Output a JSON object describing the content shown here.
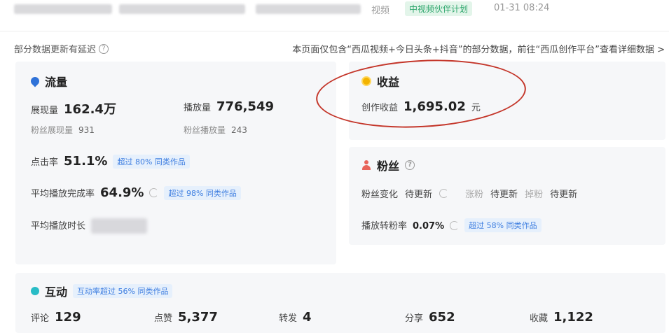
{
  "header": {
    "tag_video": "视频",
    "tag_plan": "中视频伙伴计划",
    "timestamp": "01-31 08:24"
  },
  "notice": {
    "left": "部分数据更新有延迟",
    "right": "本页面仅包含“西瓜视频+今日头条+抖音”的部分数据，前往“西瓜创作平台”查看详细数据 >"
  },
  "traffic": {
    "title": "流量",
    "impressions_label": "展现量",
    "impressions_value": "162.4万",
    "plays_label": "播放量",
    "plays_value": "776,549",
    "fan_impressions_label": "粉丝展现量",
    "fan_impressions_value": "931",
    "fan_plays_label": "粉丝播放量",
    "fan_plays_value": "243",
    "ctr_label": "点击率",
    "ctr_value": "51.1%",
    "ctr_badge": "超过 80% 同类作品",
    "completion_label": "平均播放完成率",
    "completion_value": "64.9%",
    "completion_badge": "超过 98% 同类作品",
    "duration_label": "平均播放时长"
  },
  "revenue": {
    "title": "收益",
    "label": "创作收益",
    "value": "1,695.02",
    "unit": "元"
  },
  "fans": {
    "title": "粉丝",
    "change_label": "粉丝变化",
    "change_value": "待更新",
    "gain_label": "涨粉",
    "gain_value": "待更新",
    "loss_label": "掉粉",
    "loss_value": "待更新",
    "conversion_label": "播放转粉率",
    "conversion_value": "0.07%",
    "conversion_badge": "超过 58% 同类作品"
  },
  "interaction": {
    "title": "互动",
    "badge": "互动率超过 56% 同类作品",
    "comments_label": "评论",
    "comments_value": "129",
    "likes_label": "点赞",
    "likes_value": "5,377",
    "shares_label": "转发",
    "shares_value": "4",
    "share_label": "分享",
    "share_value": "652",
    "favorites_label": "收藏",
    "favorites_value": "1,122"
  },
  "icons": {
    "traffic": "drop-icon",
    "revenue": "coin-icon",
    "fans": "person-icon",
    "interaction": "dot-icon"
  }
}
